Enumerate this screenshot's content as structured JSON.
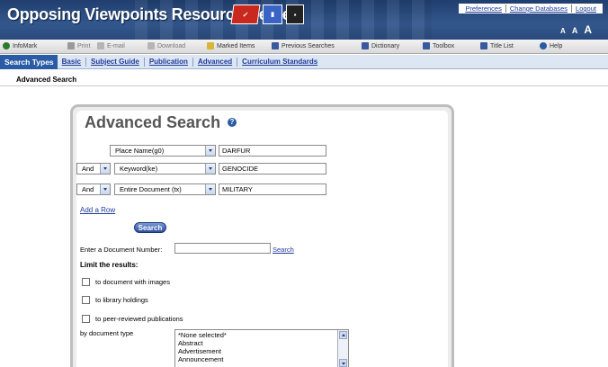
{
  "header": {
    "title": "Opposing Viewpoints Resource Center",
    "links": [
      "Preferences",
      "Change Databases",
      "Logout"
    ],
    "text_size": [
      "A",
      "A",
      "A"
    ]
  },
  "toolbar": [
    {
      "label": "InfoMark",
      "icon": "infomark-icon",
      "color": "#2a7a2a"
    },
    {
      "label": "Print",
      "icon": "print-icon",
      "color": "#9a9a9a"
    },
    {
      "label": "E-mail",
      "icon": "email-icon",
      "color": "#9a9a9a"
    },
    {
      "label": "Download",
      "icon": "download-icon",
      "color": "#9a9a9a"
    },
    {
      "label": "Marked Items",
      "icon": "folder-icon",
      "color": "#d9b43a"
    },
    {
      "label": "Previous Searches",
      "icon": "previous-searches-icon",
      "color": "#3a5aa0"
    },
    {
      "label": "Dictionary",
      "icon": "dictionary-icon",
      "color": "#3a5aa0"
    },
    {
      "label": "Toolbox",
      "icon": "toolbox-icon",
      "color": "#3a5aa0"
    },
    {
      "label": "Title List",
      "icon": "title-list-icon",
      "color": "#3a5aa0"
    },
    {
      "label": "Help",
      "icon": "help-icon",
      "color": "#2a5ca6"
    }
  ],
  "tabs": {
    "lead": "Search Types",
    "items": [
      "Basic",
      "Subject Guide",
      "Publication",
      "Advanced",
      "Curriculum Standards"
    ]
  },
  "breadcrumb": "Advanced Search",
  "form": {
    "heading": "Advanced Search",
    "help": "?",
    "rows": [
      {
        "operator": "",
        "field": "Place Name(g0)",
        "value": "DARFUR"
      },
      {
        "operator": "And",
        "field": "Keyword(ke)",
        "value": "GENOCIDE"
      },
      {
        "operator": "And",
        "field": "Entire Document (tx)",
        "value": "MILITARY"
      }
    ],
    "add_row": "Add a Row",
    "search_button": "Search",
    "doc_number_label": "Enter a Document Number:",
    "doc_number_value": "",
    "doc_number_search": "Search",
    "limit_heading": "Limit the results:",
    "limits": [
      "to document with images",
      "to library holdings",
      "to peer-reviewed publications"
    ],
    "doc_type_label": "by document type",
    "doc_type_options": [
      "*None selected*",
      "Abstract",
      "Advertisement",
      "Announcement"
    ]
  }
}
